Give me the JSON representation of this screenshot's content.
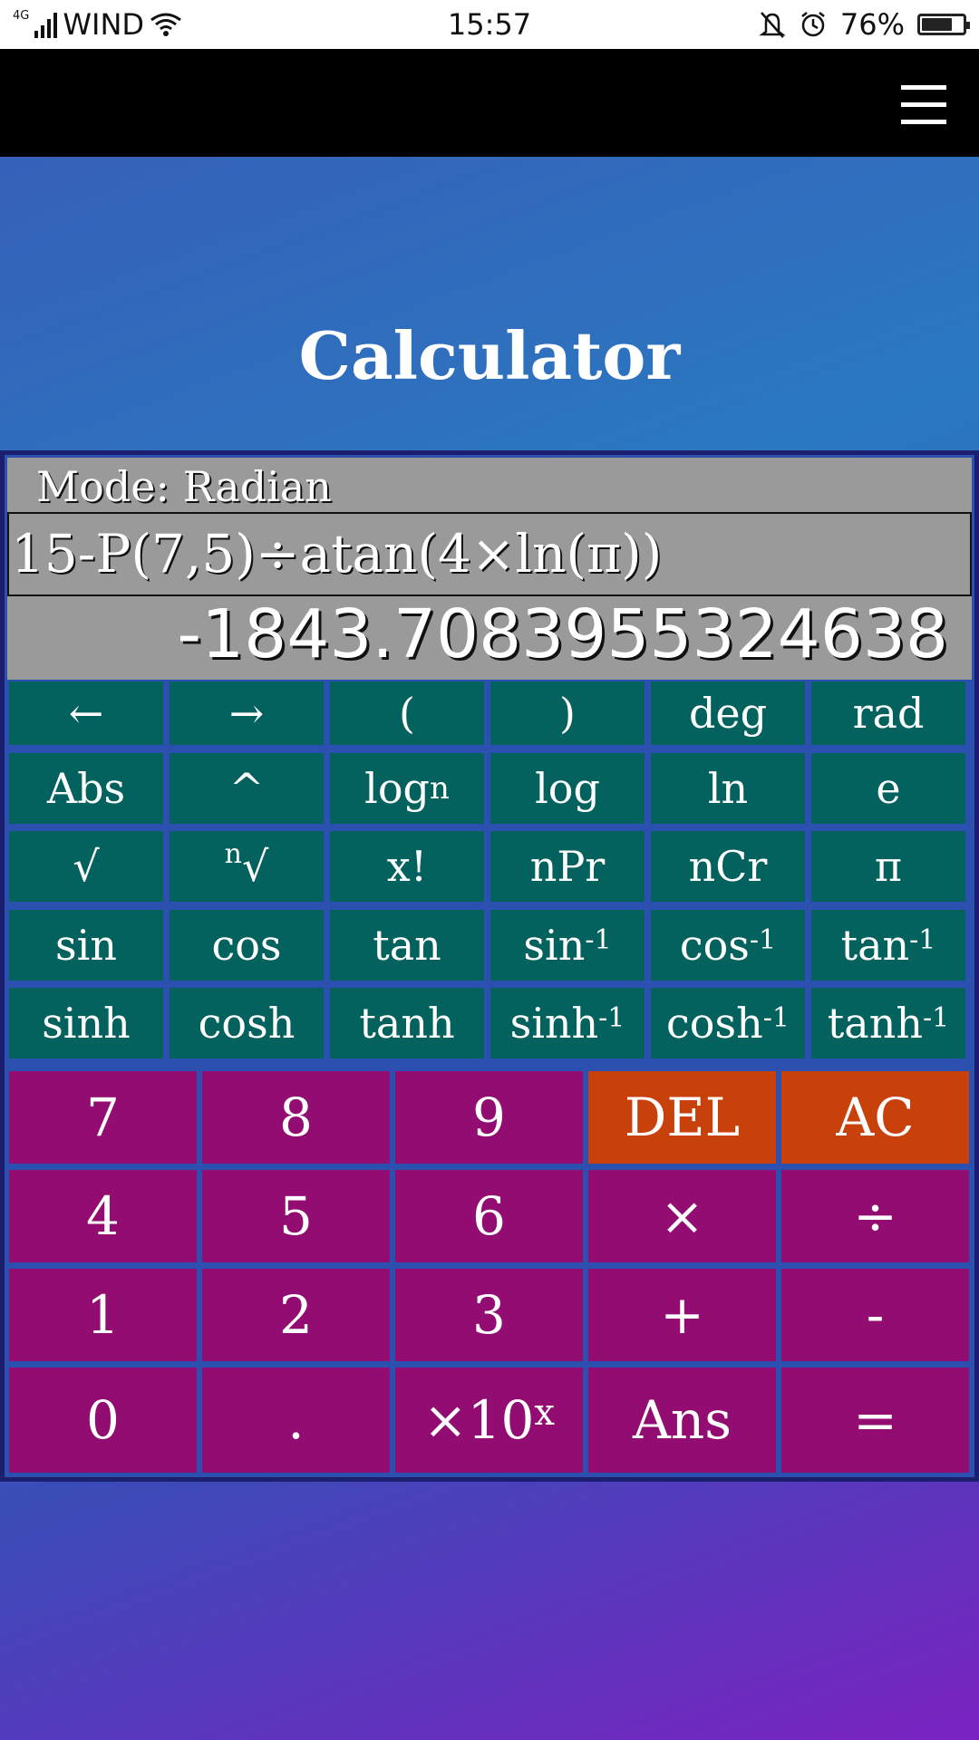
{
  "status_bar": {
    "network": "4G",
    "carrier": "WIND",
    "time": "15:57",
    "battery_percent": "76%",
    "battery_level": 0.76,
    "icons": [
      "signal-icon",
      "wifi-icon",
      "bell-off-icon",
      "alarm-icon",
      "battery-icon"
    ]
  },
  "app_bar": {
    "menu_icon": "hamburger-menu-icon"
  },
  "page": {
    "title": "Calculator"
  },
  "display": {
    "mode_label": "Mode: Radian",
    "expression": "15-P(7,5)÷atan(4×ln(π))",
    "result": "-1843.7083955324638"
  },
  "scientific_keys": [
    [
      {
        "label": "←"
      },
      {
        "label": "→"
      },
      {
        "label": "("
      },
      {
        "label": ")"
      },
      {
        "label": "deg"
      },
      {
        "label": "rad"
      }
    ],
    [
      {
        "label": "Abs"
      },
      {
        "label": "^"
      },
      {
        "label": "log",
        "sub": "n"
      },
      {
        "label": "log"
      },
      {
        "label": "ln"
      },
      {
        "label": "e"
      }
    ],
    [
      {
        "label": "√"
      },
      {
        "label": "√",
        "pre": "n"
      },
      {
        "label": "x!"
      },
      {
        "label": "nPr"
      },
      {
        "label": "nCr"
      },
      {
        "label": "π"
      }
    ],
    [
      {
        "label": "sin"
      },
      {
        "label": "cos"
      },
      {
        "label": "tan"
      },
      {
        "label": "sin",
        "sup": "-1"
      },
      {
        "label": "cos",
        "sup": "-1"
      },
      {
        "label": "tan",
        "sup": "-1"
      }
    ],
    [
      {
        "label": "sinh"
      },
      {
        "label": "cosh"
      },
      {
        "label": "tanh"
      },
      {
        "label": "sinh",
        "sup": "-1"
      },
      {
        "label": "cosh",
        "sup": "-1"
      },
      {
        "label": "tanh",
        "sup": "-1"
      }
    ]
  ],
  "number_keys": [
    [
      {
        "label": "7"
      },
      {
        "label": "8"
      },
      {
        "label": "9"
      },
      {
        "label": "DEL",
        "style": "orange"
      },
      {
        "label": "AC",
        "style": "orange"
      }
    ],
    [
      {
        "label": "4"
      },
      {
        "label": "5"
      },
      {
        "label": "6"
      },
      {
        "label": "×"
      },
      {
        "label": "÷"
      }
    ],
    [
      {
        "label": "1"
      },
      {
        "label": "2"
      },
      {
        "label": "3"
      },
      {
        "label": "+"
      },
      {
        "label": "-"
      }
    ],
    [
      {
        "label": "0"
      },
      {
        "label": "."
      },
      {
        "label": "×10",
        "sup": "x"
      },
      {
        "label": "Ans"
      },
      {
        "label": "="
      }
    ]
  ],
  "colors": {
    "scientific_key": "#03625e",
    "number_key": "#920c72",
    "clear_key": "#c8400a",
    "display": "#9a9a9a",
    "app_bar": "#000000"
  }
}
